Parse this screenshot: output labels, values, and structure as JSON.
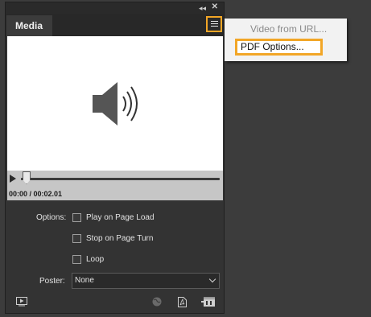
{
  "panel": {
    "tab_label": "Media",
    "collapse_glyph": "◂◂",
    "close_glyph": "✕",
    "menu_icon": "panel-menu-icon"
  },
  "preview": {
    "icon": "speaker-volume-icon"
  },
  "playback": {
    "time_text": "00:00 / 00:02.01",
    "position": 0
  },
  "options": {
    "label": "Options:",
    "play_on_page_load": {
      "label": "Play on Page Load",
      "checked": false
    },
    "stop_on_page_turn": {
      "label": "Stop on Page Turn",
      "checked": false
    },
    "loop": {
      "label": "Loop",
      "checked": false
    }
  },
  "poster": {
    "label": "Poster:",
    "value": "None"
  },
  "footer": {
    "icons": [
      "preview-icon",
      "globe-icon",
      "pdf-icon",
      "video-clapper-icon"
    ]
  },
  "flyout": {
    "video_from_url": "Video from URL...",
    "pdf_options": "PDF Options..."
  },
  "colors": {
    "highlight": "#f2a626",
    "panel_bg": "#333333",
    "preview_bg": "#ffffff"
  }
}
